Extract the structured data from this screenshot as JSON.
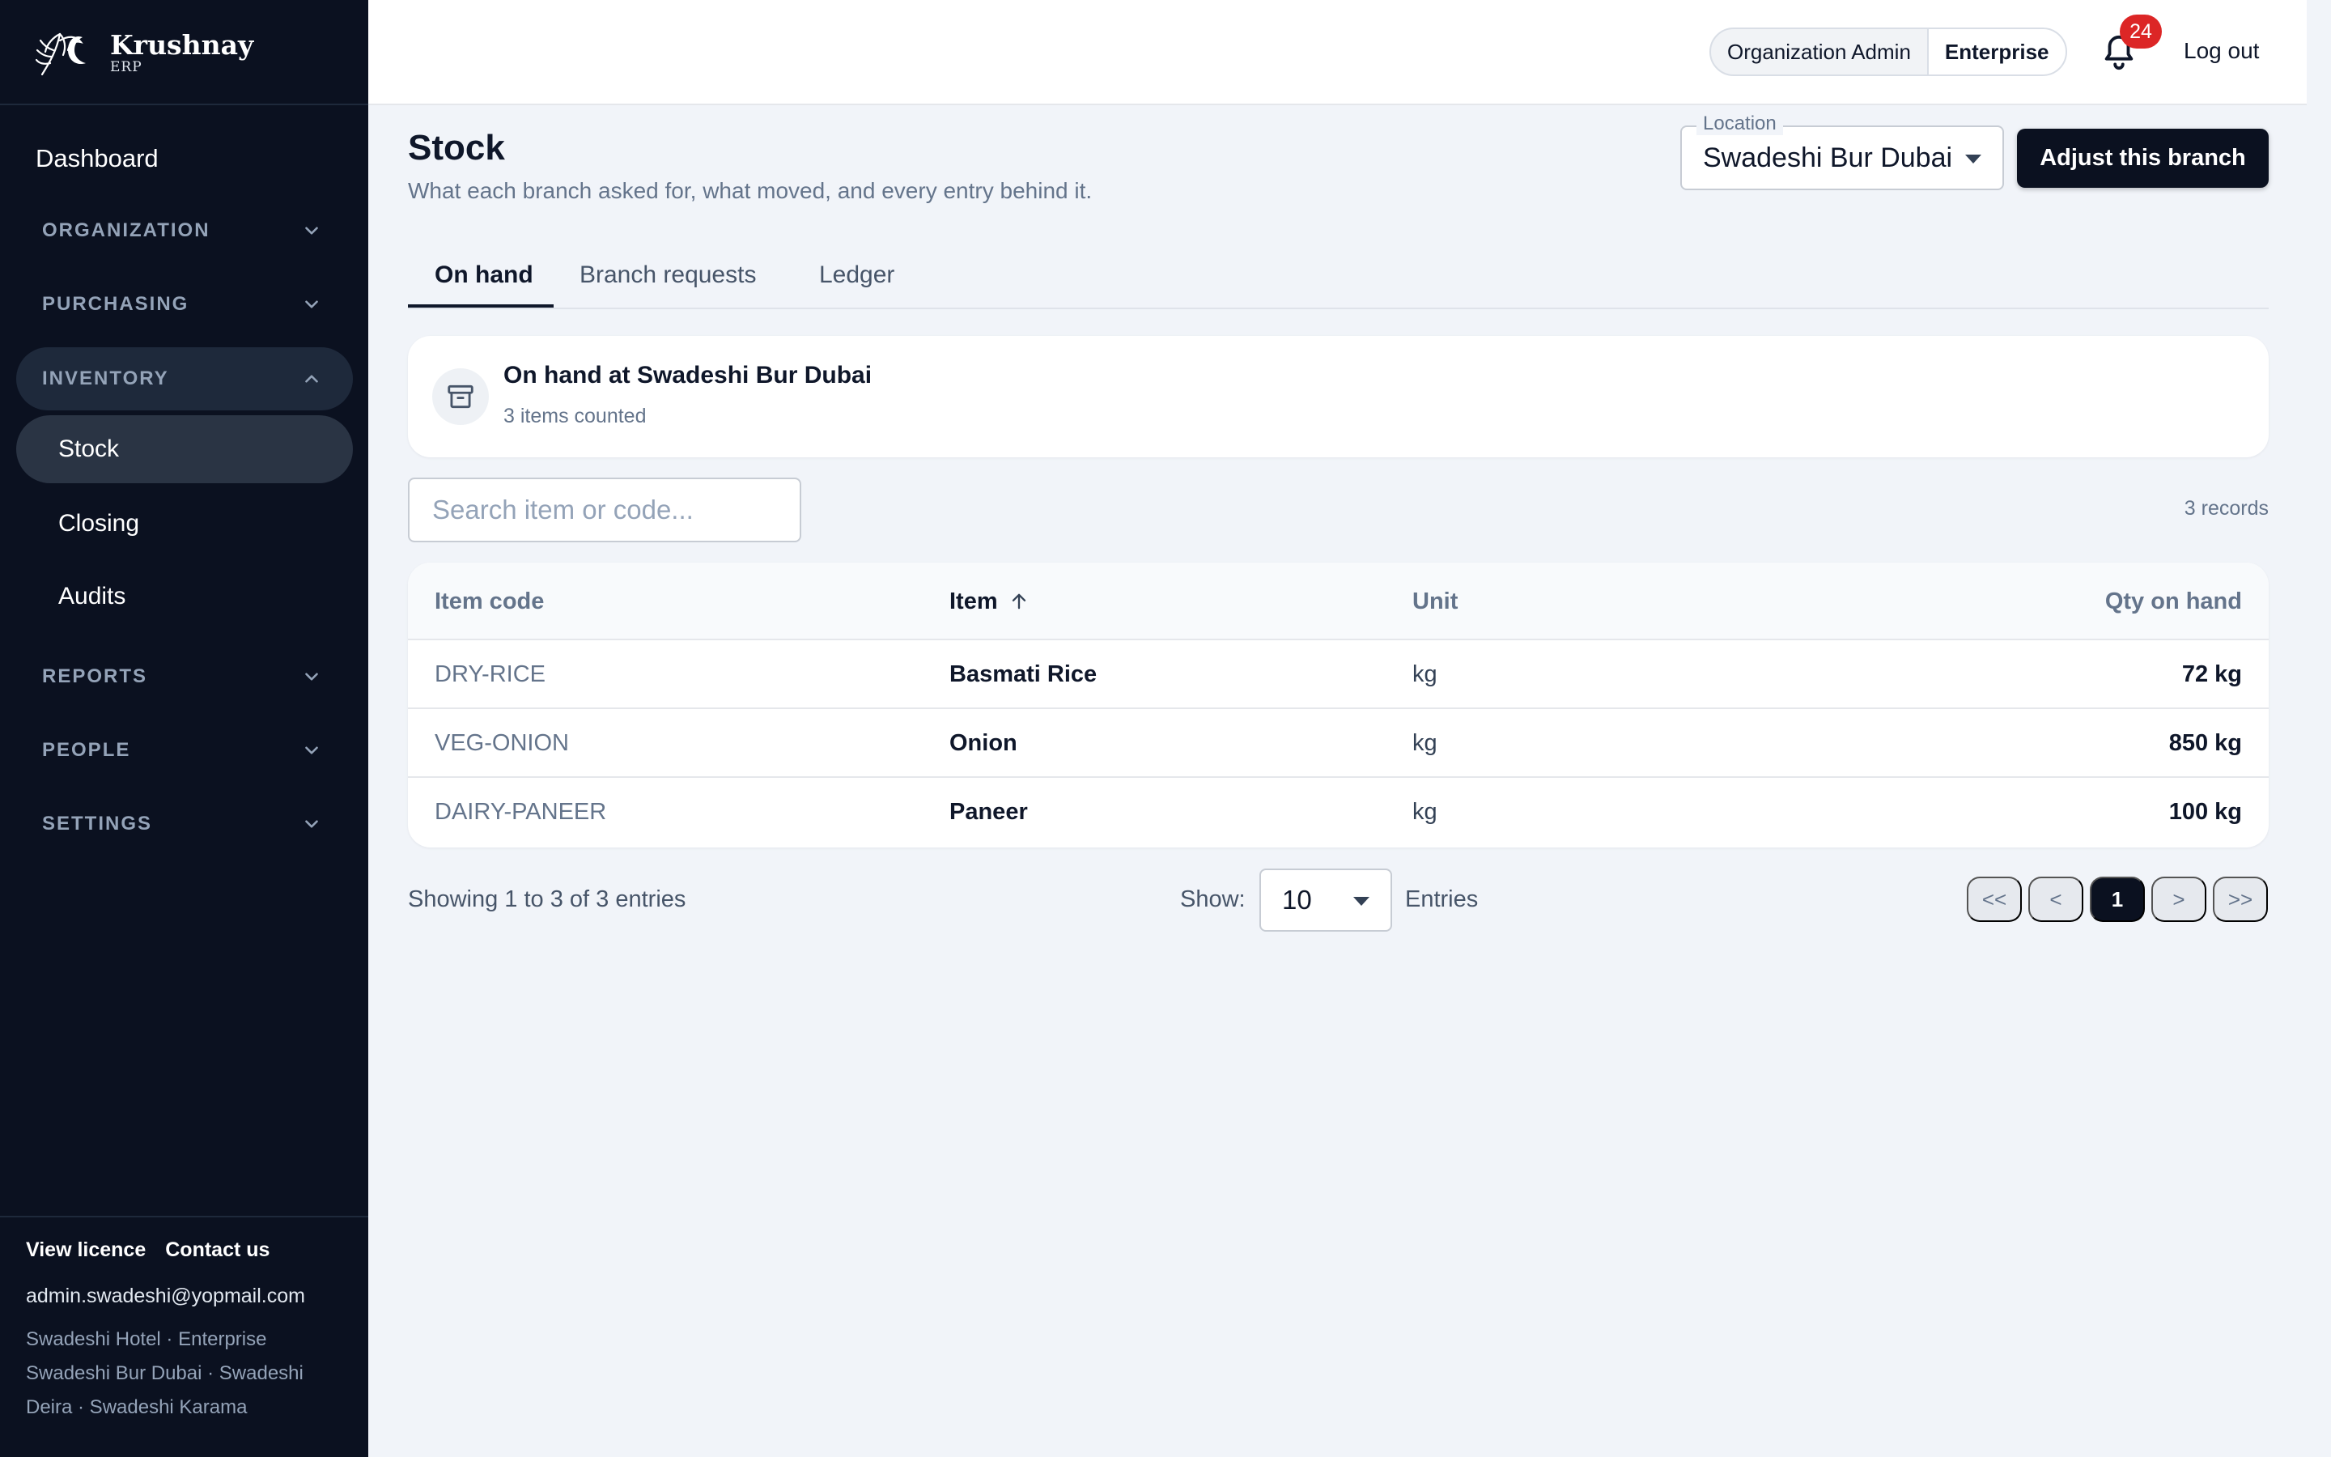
{
  "brand": {
    "name": "Krushnay",
    "sub": "ERP"
  },
  "sidebar": {
    "dashboard": "Dashboard",
    "groups": {
      "organization": "ORGANIZATION",
      "purchasing": "PURCHASING",
      "inventory": "INVENTORY",
      "reports": "REPORTS",
      "people": "PEOPLE",
      "settings": "SETTINGS"
    },
    "inventory_items": [
      "Stock",
      "Closing",
      "Audits"
    ],
    "footer": {
      "view_licence": "View licence",
      "contact_us": "Contact us",
      "email": "admin.swadeshi@yopmail.com",
      "org_line": "Swadeshi Hotel · Enterprise",
      "branches_line1": "Swadeshi Bur Dubai · Swadeshi",
      "branches_line2": "Deira · Swadeshi Karama"
    }
  },
  "topbar": {
    "role": "Organization Admin",
    "tier": "Enterprise",
    "notifications": "24",
    "logout": "Log out"
  },
  "page": {
    "title": "Stock",
    "subtitle": "What each branch asked for, what moved, and every entry behind it.",
    "location_label": "Location",
    "location_value": "Swadeshi Bur Dubai",
    "adjust_button": "Adjust this branch",
    "tabs": [
      "On hand",
      "Branch requests",
      "Ledger"
    ]
  },
  "summary": {
    "title": "On hand at Swadeshi Bur Dubai",
    "subtitle": "3 items counted"
  },
  "search": {
    "placeholder": "Search item or code..."
  },
  "records": "3 records",
  "table": {
    "headers": {
      "code": "Item code",
      "item": "Item",
      "unit": "Unit",
      "qty": "Qty on hand"
    },
    "rows": [
      {
        "code": "DRY-RICE",
        "item": "Basmati Rice",
        "unit": "kg",
        "qty": "72 kg"
      },
      {
        "code": "VEG-ONION",
        "item": "Onion",
        "unit": "kg",
        "qty": "850 kg"
      },
      {
        "code": "DAIRY-PANEER",
        "item": "Paneer",
        "unit": "kg",
        "qty": "100 kg"
      }
    ]
  },
  "pagination": {
    "showing": "Showing 1 to 3 of 3 entries",
    "show_label": "Show:",
    "page_size": "10",
    "entries_label": "Entries",
    "first": "<<",
    "prev": "<",
    "current": "1",
    "next": ">",
    "last": ">>"
  },
  "icons": {
    "logo": "peacock-feather-logo",
    "notification": "bell-icon",
    "summary": "archive-box-icon",
    "sort": "arrow-up-icon",
    "group_toggle": "chevron-icon"
  },
  "colors": {
    "sidebar_bg": "#0b1120",
    "page_bg": "#f1f4f9",
    "primary_button": "#0b1120",
    "badge": "#dc2626"
  }
}
